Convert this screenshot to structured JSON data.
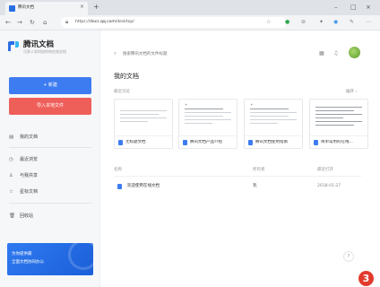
{
  "browser": {
    "tab_title": "腾讯文档",
    "tab_close": "×",
    "new_tab": "+",
    "url_prefix": "https://",
    "url_host": "docs.qq.com",
    "url_path": "/desktop/",
    "window_controls": {
      "minimize": "–",
      "maximize": "□",
      "close": "×"
    }
  },
  "sidebar": {
    "app_name": "腾讯文档",
    "app_subtitle": "可多人实时协作的在线文档",
    "new_button": "+ 新建",
    "import_button": "导入本地文件",
    "nav": [
      {
        "label": "我的文档",
        "icon": "document-icon"
      },
      {
        "label": "最近浏览",
        "icon": "clock-icon"
      },
      {
        "label": "与我共享",
        "icon": "shared-icon"
      },
      {
        "label": "星标文档",
        "icon": "star-icon"
      },
      {
        "label": "回收站",
        "icon": "trash-icon"
      }
    ],
    "promo": {
      "line1": "为你提供最",
      "line2": "全面文档协同办公"
    }
  },
  "main": {
    "search_placeholder": "搜索腾讯文档的文件标题",
    "title": "我的文档",
    "recent_label": "最近浏览",
    "more_label": "展开 ›",
    "cards": [
      {
        "name": "无标题文档"
      },
      {
        "name": "腾讯文档产品介绍"
      },
      {
        "name": "腾讯文档使用指南"
      },
      {
        "name": "简单常用的在线..."
      }
    ],
    "list_headers": {
      "name": "名称",
      "owner": "所有者",
      "date": "最近打开"
    },
    "rows": [
      {
        "name": "欢迎使用在线文档",
        "owner": "我",
        "date": "2018-01-27"
      }
    ],
    "help_label": "?",
    "badge": "3"
  },
  "colors": {
    "primary": "#3d7cf0",
    "import": "#ef5f5a",
    "badge": "#e23b2e"
  }
}
